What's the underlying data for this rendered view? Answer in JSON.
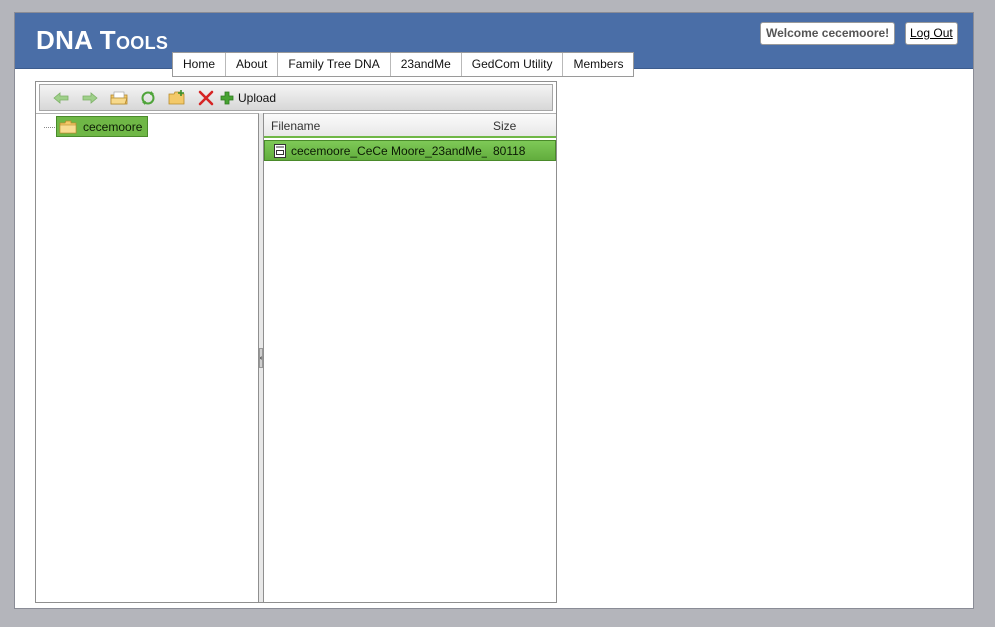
{
  "header": {
    "logo": "DNA Tools",
    "welcome": "Welcome cecemoore!",
    "logout": "Log Out"
  },
  "nav": {
    "items": [
      "Home",
      "About",
      "Family Tree DNA",
      "23andMe",
      "GedCom Utility",
      "Members"
    ]
  },
  "toolbar": {
    "icons": [
      "back-arrow-icon",
      "forward-arrow-icon",
      "open-folder-icon",
      "refresh-icon",
      "new-folder-icon",
      "delete-icon",
      "plus-icon"
    ],
    "upload_label": "Upload"
  },
  "tree": {
    "root_label": "cecemoore"
  },
  "file_list": {
    "columns": {
      "filename": "Filename",
      "size": "Size"
    },
    "rows": [
      {
        "filename": "cecemoore_CeCe Moore_23andMe_",
        "size": "80118"
      }
    ]
  },
  "colors": {
    "header_bg": "#4a6ea7",
    "selection_green": "#6fb746",
    "page_bg": "#b4b5bb"
  }
}
